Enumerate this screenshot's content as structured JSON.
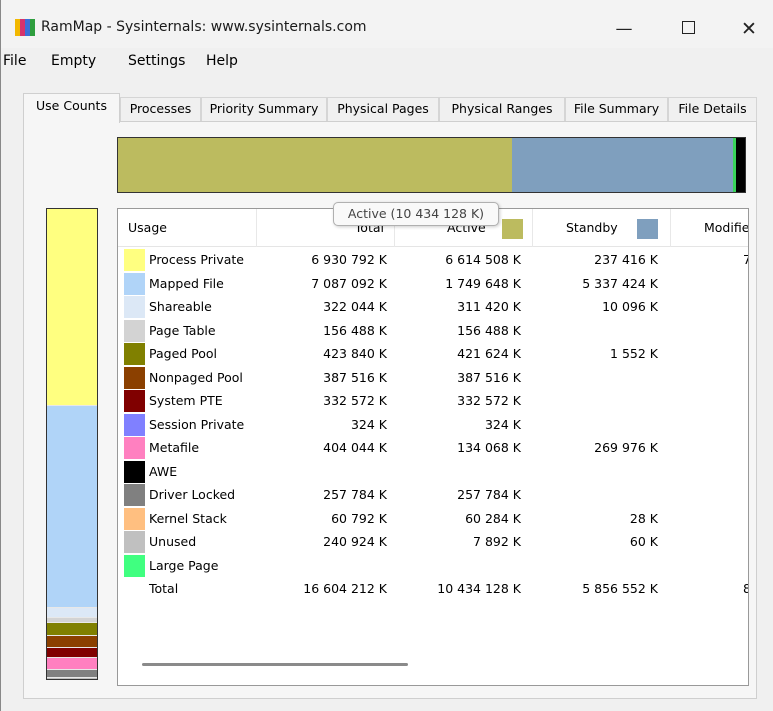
{
  "window": {
    "title": "RamMap - Sysinternals: www.sysinternals.com",
    "controls": {
      "minimize": "—",
      "close": "✕"
    }
  },
  "menu": [
    "File",
    "Empty",
    "Settings",
    "Help"
  ],
  "tabs": [
    "Use Counts",
    "Processes",
    "Priority Summary",
    "Physical Pages",
    "Physical Ranges",
    "File Summary",
    "File Details"
  ],
  "active_tab": "Use Counts",
  "top_bar": {
    "segments": [
      {
        "name": "Active",
        "fraction": 0.6284,
        "color": "#bcbb5f"
      },
      {
        "name": "Standby",
        "fraction": 0.3527,
        "color": "#7f9fbe"
      },
      {
        "name": "Modified",
        "fraction": 0.004,
        "color": "#3ad45a"
      },
      {
        "name": "Other",
        "fraction": 0.0149,
        "color": "#000000"
      }
    ]
  },
  "tooltip": "Active (10 434 128 K)",
  "columns": {
    "usage": "Usage",
    "total": "Total",
    "active": "Active",
    "standby": "Standby",
    "modified": "Modifie",
    "active_color": "#bcbb5f",
    "standby_color": "#7f9fbe"
  },
  "rows": [
    {
      "label": "Process Private",
      "color": "#ffff80",
      "total": "6 930 792 K",
      "active": "6 614 508 K",
      "standby": "237 416 K",
      "modified": "7"
    },
    {
      "label": "Mapped File",
      "color": "#b0d4f8",
      "total": "7 087 092 K",
      "active": "1 749 648 K",
      "standby": "5 337 424 K",
      "modified": ""
    },
    {
      "label": "Shareable",
      "color": "#dce8f6",
      "total": "322 044 K",
      "active": "311 420 K",
      "standby": "10 096 K",
      "modified": ""
    },
    {
      "label": "Page Table",
      "color": "#d3d3d3",
      "total": "156 488 K",
      "active": "156 488 K",
      "standby": "",
      "modified": ""
    },
    {
      "label": "Paged Pool",
      "color": "#808000",
      "total": "423 840 K",
      "active": "421 624 K",
      "standby": "1 552 K",
      "modified": ""
    },
    {
      "label": "Nonpaged Pool",
      "color": "#8b4000",
      "total": "387 516 K",
      "active": "387 516 K",
      "standby": "",
      "modified": ""
    },
    {
      "label": "System PTE",
      "color": "#800000",
      "total": "332 572 K",
      "active": "332 572 K",
      "standby": "",
      "modified": ""
    },
    {
      "label": "Session Private",
      "color": "#8080ff",
      "total": "324 K",
      "active": "324 K",
      "standby": "",
      "modified": ""
    },
    {
      "label": "Metafile",
      "color": "#ff80c0",
      "total": "404 044 K",
      "active": "134 068 K",
      "standby": "269 976 K",
      "modified": ""
    },
    {
      "label": "AWE",
      "color": "#000000",
      "total": "",
      "active": "",
      "standby": "",
      "modified": ""
    },
    {
      "label": "Driver Locked",
      "color": "#808080",
      "total": "257 784 K",
      "active": "257 784 K",
      "standby": "",
      "modified": ""
    },
    {
      "label": "Kernel Stack",
      "color": "#ffbf80",
      "total": "60 792 K",
      "active": "60 284 K",
      "standby": "28 K",
      "modified": ""
    },
    {
      "label": "Unused",
      "color": "#c0c0c0",
      "total": "240 924 K",
      "active": "7 892 K",
      "standby": "60 K",
      "modified": ""
    },
    {
      "label": "Large Page",
      "color": "#40ff80",
      "total": "",
      "active": "",
      "standby": "",
      "modified": ""
    },
    {
      "label": "Total",
      "color": "",
      "total": "16 604 212 K",
      "active": "10 434 128 K",
      "standby": "5 856 552 K",
      "modified": "8"
    }
  ],
  "left_bar": {
    "segments": [
      {
        "name": "Process Private",
        "fraction": 0.4174,
        "color": "#ffff80"
      },
      {
        "name": "Mapped File",
        "fraction": 0.4268,
        "color": "#b0d4f8"
      },
      {
        "name": "Shareable",
        "fraction": 0.0194,
        "color": "#dce8f6"
      },
      {
        "name": "Page Table",
        "fraction": 0.0094,
        "color": "#d3d3d3"
      },
      {
        "name": "Paged Pool",
        "fraction": 0.0255,
        "color": "#808000"
      },
      {
        "name": "Nonpaged Pool",
        "fraction": 0.0233,
        "color": "#8b4000"
      },
      {
        "name": "System PTE",
        "fraction": 0.02,
        "color": "#800000"
      },
      {
        "name": "Metafile",
        "fraction": 0.0243,
        "color": "#ff80c0"
      },
      {
        "name": "Driver Locked",
        "fraction": 0.0155,
        "color": "#808080"
      },
      {
        "name": "Unused",
        "fraction": 0.0145,
        "color": "#c0c0c0"
      }
    ]
  }
}
